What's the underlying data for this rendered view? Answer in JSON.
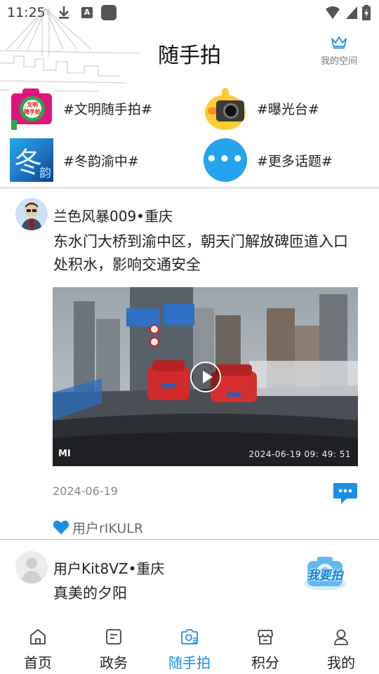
{
  "status_bar": {
    "time": "11:25",
    "notif_letter": "A"
  },
  "header": {
    "title": "随手拍",
    "my_space": "我的空间"
  },
  "topics": [
    {
      "label": "#文明随手拍#",
      "icon": "civil-camera-icon",
      "icon_text": "文明\n随手拍"
    },
    {
      "label": "#曝光台#",
      "icon": "duck-camera-icon"
    },
    {
      "label": "#冬韵渝中#",
      "icon": "winter-icon",
      "icon_text": "冬",
      "icon_text2": "韵"
    },
    {
      "label": "#更多话题#",
      "icon": "more-dots-icon",
      "icon_text": "•••"
    }
  ],
  "posts": [
    {
      "user": "兰色风暴009•重庆",
      "text": "东水门大桥到渝中区，朝天门解放碑匝道入口处积水，影响交通安全",
      "video": {
        "brand": "MI",
        "stamp": "2024-06-19 09: 49: 51"
      },
      "date": "2024-06-19",
      "liked_by": "用户rIKULR"
    },
    {
      "user": "用户Kit8VZ•重庆",
      "text": "真美的夕阳"
    }
  ],
  "fab": {
    "label": "我要拍"
  },
  "bottom_nav": [
    {
      "label": "首页",
      "icon": "home-icon"
    },
    {
      "label": "政务",
      "icon": "document-icon"
    },
    {
      "label": "随手拍",
      "icon": "camera-icon",
      "active": true
    },
    {
      "label": "积分",
      "icon": "points-icon"
    },
    {
      "label": "我的",
      "icon": "profile-icon"
    }
  ],
  "colors": {
    "accent": "#1a8fe3",
    "divider": "#e6e6e6",
    "text": "#222222",
    "muted": "#888888"
  }
}
